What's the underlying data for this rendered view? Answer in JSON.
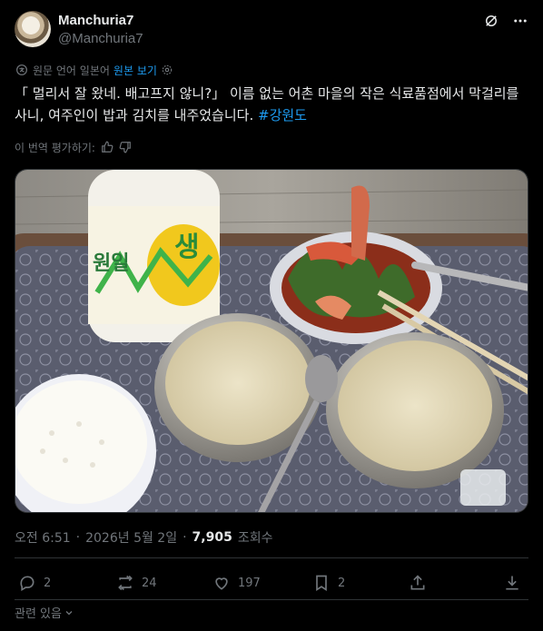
{
  "author": {
    "display_name": "Manchuria7",
    "handle": "@Manchuria7"
  },
  "translation": {
    "notice": "원문 언어 일본어",
    "show_original": "원본 보기"
  },
  "post": {
    "text": "「 멀리서 잘 왔네. 배고프지 않니?」 이름 없는 어촌 마을의 작은 식료품점에서 막걸리를 사니, 여주인이 밥과 김치를 내주었습니다.",
    "hashtag": "#강원도"
  },
  "rate_translation": {
    "label": "이 번역 평가하기:"
  },
  "photo": {
    "bottle_label": "생",
    "bottle_brand": "원일"
  },
  "meta": {
    "time": "오전 6:51",
    "dot": "·",
    "date": "2026년 5월 2일",
    "dot2": "·",
    "views": "7,905",
    "views_label": "조회수"
  },
  "actions": {
    "replies": "2",
    "reposts": "24",
    "likes": "197",
    "bookmarks": "2"
  },
  "footer": {
    "related": "관련 있음"
  },
  "colors": {
    "background": "#000000",
    "text": "#e7e9ea",
    "muted": "#71767b",
    "accent": "#1d9bf0",
    "border": "#2f3336"
  }
}
